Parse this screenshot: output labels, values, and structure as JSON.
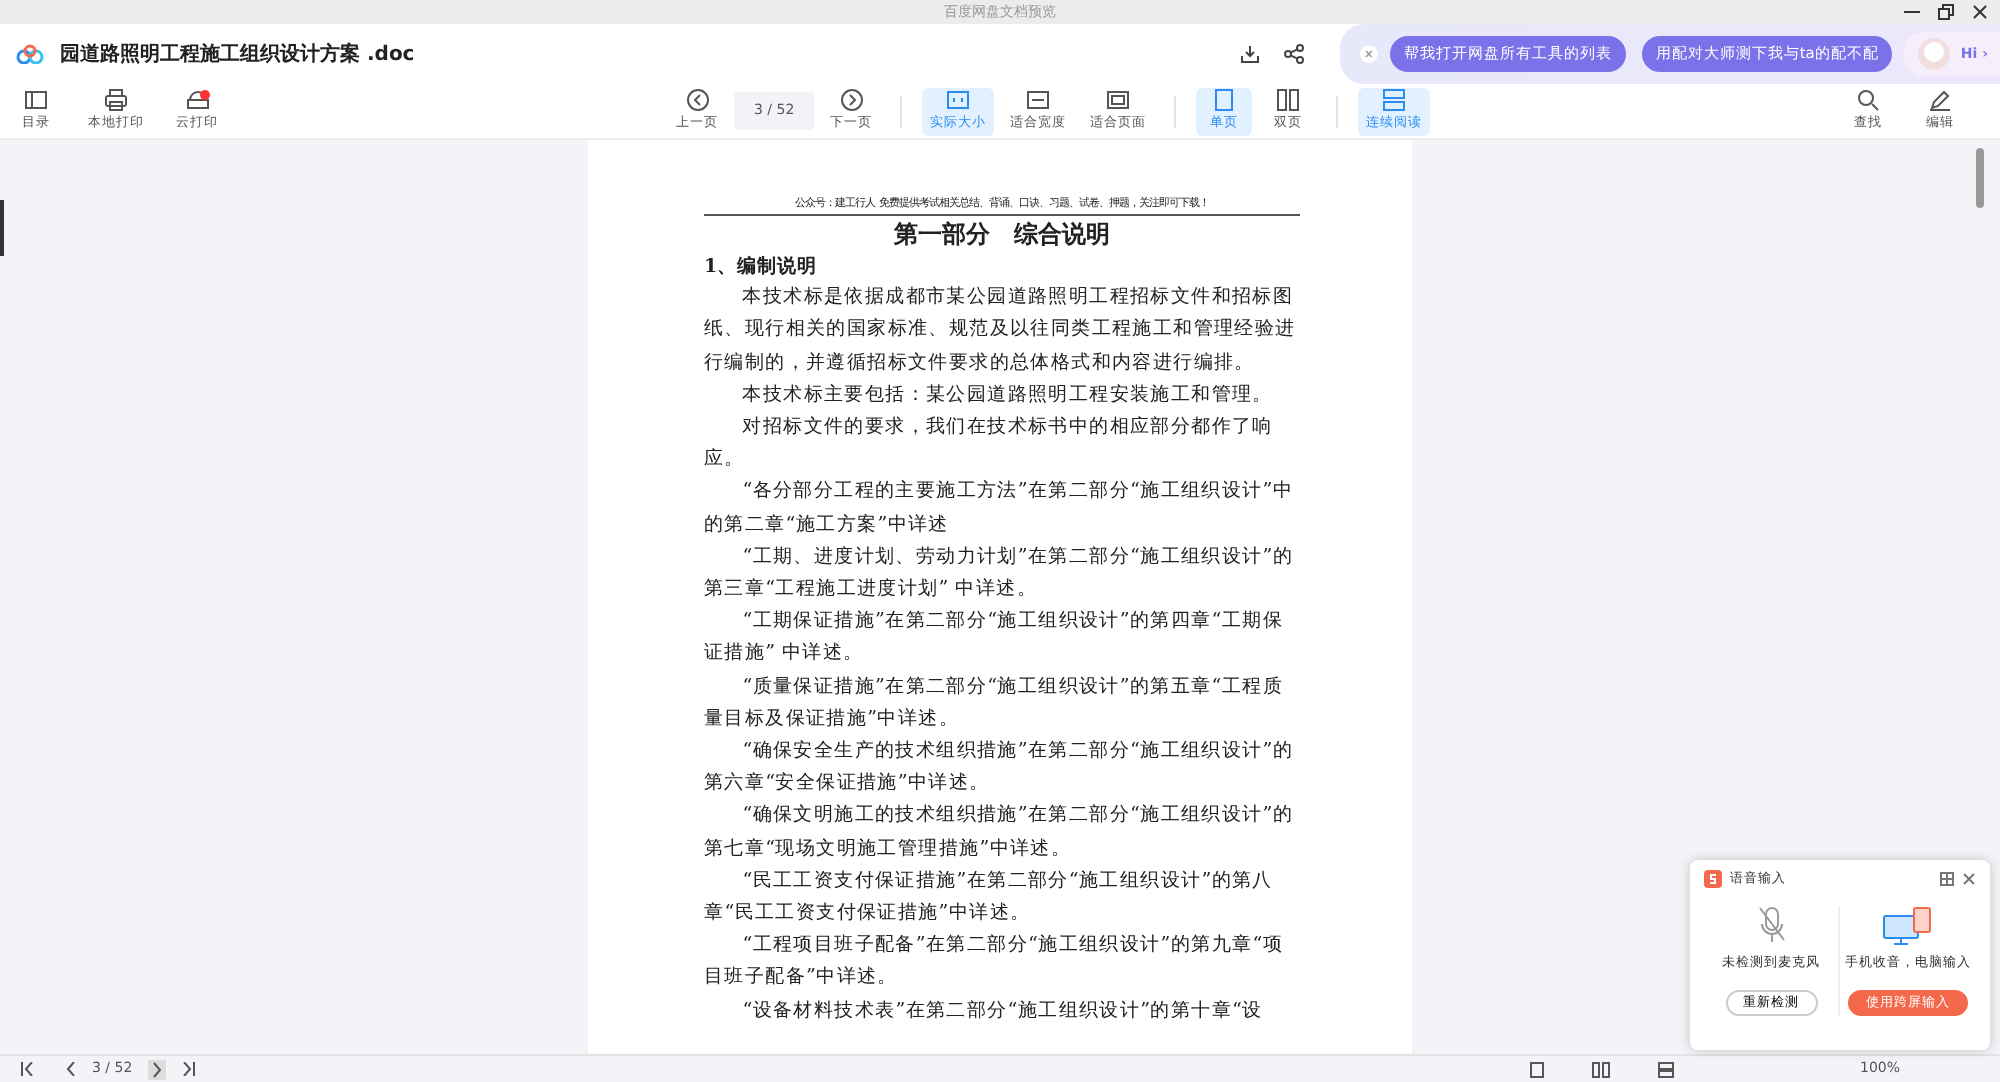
{
  "window": {
    "title": "百度网盘文档预览"
  },
  "file": {
    "name": "园道路照明工程施工组织设计方案 .doc"
  },
  "assistant": {
    "suggestions": [
      "帮我打开网盘所有工具的列表",
      "用配对大师测下我与ta的配不配"
    ],
    "greeting": "Hi ›"
  },
  "toolbar": {
    "left": [
      {
        "label": "目录",
        "notify": false
      },
      {
        "label": "本地打印",
        "notify": false
      },
      {
        "label": "云打印",
        "notify": true
      }
    ],
    "page_input": "3  / 52",
    "prev": "上一页",
    "next": "下一页",
    "views": [
      {
        "label": "实际大小",
        "selected": true
      },
      {
        "label": "适合宽度",
        "selected": false
      },
      {
        "label": "适合页面",
        "selected": false
      },
      {
        "label": "单页",
        "selected": true
      },
      {
        "label": "双页",
        "selected": false
      },
      {
        "label": "连续阅读",
        "selected": true
      }
    ],
    "right": [
      {
        "label": "查找"
      },
      {
        "label": "编辑"
      }
    ]
  },
  "document": [
    {
      "kind": "header",
      "text": "公众号：建工行人 免费提供考试相关总结、背诵、口诀、习题、试卷、押题，关注即可下载！"
    },
    {
      "kind": "title",
      "text": "第一部分　综合说明"
    },
    {
      "kind": "heading",
      "text": "1、编制说明"
    },
    {
      "kind": "para",
      "text": "本技术标是依据成都市某公园道路照明工程招标文件和招标图纸、现行相关的国家标准、规范及以往同类工程施工和管理经验进行编制的，并遵循招标文件要求的总体格式和内容进行编排。"
    },
    {
      "kind": "para",
      "text": "本技术标主要包括：某公园道路照明工程安装施工和管理。"
    },
    {
      "kind": "para",
      "text": "对招标文件的要求，我们在技术标书中的相应部分都作了响应。"
    },
    {
      "kind": "para",
      "text": "“各分部分工程的主要施工方法”在第二部分“施工组织设计”中的第二章“施工方案”中详述"
    },
    {
      "kind": "para",
      "text": "“工期、进度计划、劳动力计划”在第二部分“施工组织设计”的第三章“工程施工进度计划” 中详述。"
    },
    {
      "kind": "para",
      "text": "“工期保证措施”在第二部分“施工组织设计”的第四章“工期保证措施” 中详述。"
    },
    {
      "kind": "para",
      "text": "“质量保证措施”在第二部分“施工组织设计”的第五章“工程质量目标及保证措施”中详述。"
    },
    {
      "kind": "para",
      "text": "“确保安全生产的技术组织措施”在第二部分“施工组织设计”的第六章“安全保证措施”中详述。"
    },
    {
      "kind": "para",
      "text": "“确保文明施工的技术组织措施”在第二部分“施工组织设计”的第七章“现场文明施工管理措施”中详述。"
    },
    {
      "kind": "para",
      "text": "“民工工资支付保证措施”在第二部分“施工组织设计”的第八章“民工工资支付保证措施”中详述。"
    },
    {
      "kind": "para",
      "text": "“工程项目班子配备”在第二部分“施工组织设计”的第九章“项目班子配备”中详述。"
    },
    {
      "kind": "para",
      "text": "“设备材料技术表”在第二部分“施工组织设计”的第十章“设"
    }
  ],
  "status_bar": {
    "page": "3 / 52",
    "zoom": "100%"
  },
  "voice_popup": {
    "title": "语音输入",
    "left_text": "未检测到麦克风",
    "left_button": "重新检测",
    "right_text": "手机收音，电脑输入",
    "right_button": "使用跨屏输入"
  }
}
